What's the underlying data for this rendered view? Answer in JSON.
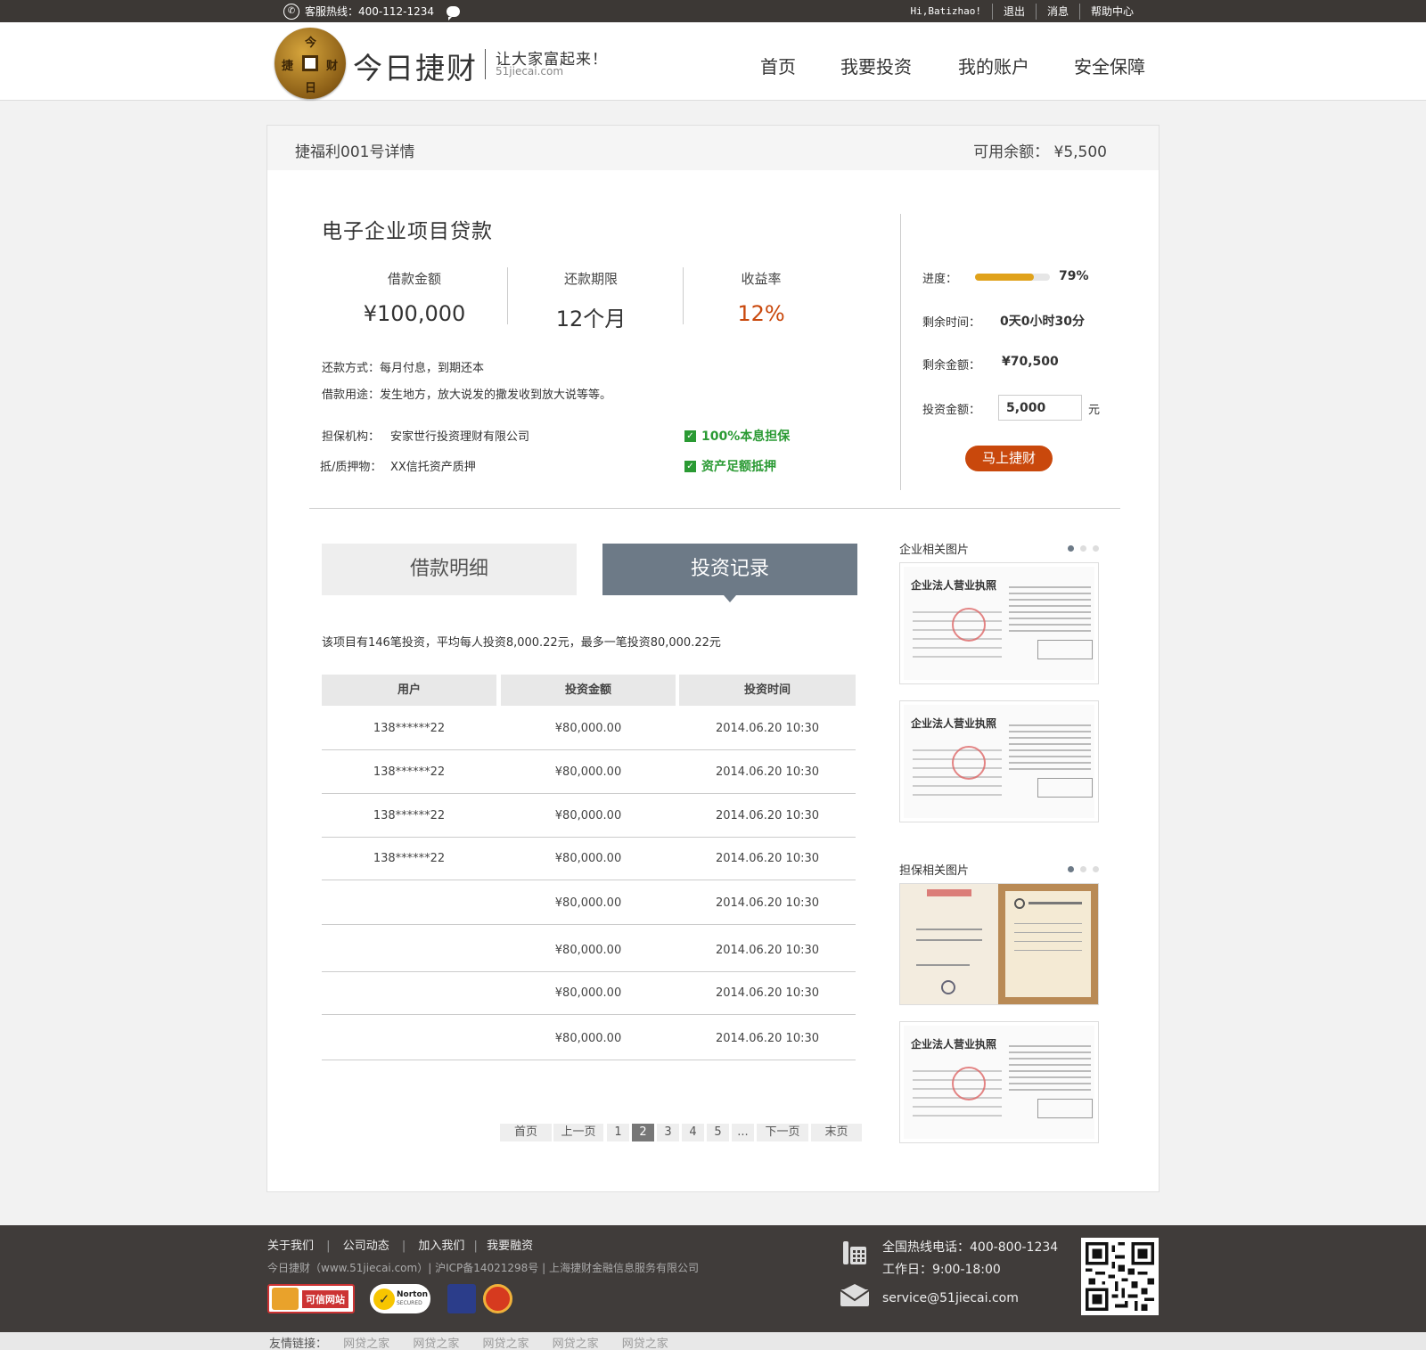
{
  "topbar": {
    "hotline": "客服热线：400-112-1234",
    "greeting": "Hi,Batizhao!",
    "logout": "退出",
    "messages": "消息",
    "help": "帮助中心"
  },
  "header": {
    "brand": "今日捷财",
    "coin_chars": [
      "今",
      "捷",
      "财",
      "日"
    ],
    "slogan": "让大家富起来！",
    "domain": "51jiecai.com",
    "nav": [
      "首页",
      "我要投资",
      "我的账户",
      "安全保障"
    ]
  },
  "card": {
    "title": "捷福利001号详情",
    "available_balance": "可用余额： ¥5,500"
  },
  "project": {
    "title": "电子企业项目贷款",
    "stats": [
      {
        "label": "借款金额",
        "value": "¥100,000"
      },
      {
        "label": "还款期限",
        "value": "12个月"
      },
      {
        "label": "收益率",
        "value": "12%"
      }
    ],
    "repay_method": "还款方式：每月付息，到期还本",
    "loan_purpose": "借款用途：发生地方，放大说发的撒发收到放大说等等。",
    "guarantor_label": "担保机构：",
    "guarantor": "安家世行投资理财有限公司",
    "collateral_label": "抵/质押物：",
    "collateral": "XX信托资产质押",
    "check1": "100%本息担保",
    "check2": "资产足额抵押"
  },
  "invest_panel": {
    "progress_label": "进度：",
    "progress_percent": 79,
    "progress_text": "79%",
    "remaining_time_label": "剩余时间：",
    "remaining_time": "0天0小时30分",
    "remaining_amount_label": "剩余金额：",
    "remaining_amount": "¥70,500",
    "invest_amount_label": "投资金额：",
    "invest_amount_value": "5,000",
    "unit": "元",
    "button": "马上捷财"
  },
  "tabs": {
    "tab1": "借款明细",
    "tab2": "投资记录"
  },
  "records": {
    "summary": "该项目有146笔投资，平均每人投资8,000.22元，最多一笔投资80,000.22元",
    "headers": [
      "用户",
      "投资金额",
      "投资时间"
    ],
    "rows": [
      {
        "user": "138******22",
        "amount": "¥80,000.00",
        "time": "2014.06.20  10:30"
      },
      {
        "user": "138******22",
        "amount": "¥80,000.00",
        "time": "2014.06.20  10:30"
      },
      {
        "user": "138******22",
        "amount": "¥80,000.00",
        "time": "2014.06.20  10:30"
      },
      {
        "user": "138******22",
        "amount": "¥80,000.00",
        "time": "2014.06.20  10:30"
      },
      {
        "user": "",
        "amount": "¥80,000.00",
        "time": "2014.06.20  10:30"
      },
      {
        "user": "",
        "amount": "¥80,000.00",
        "time": "2014.06.20  10:30"
      },
      {
        "user": "",
        "amount": "¥80,000.00",
        "time": "2014.06.20  10:30"
      },
      {
        "user": "",
        "amount": "¥80,000.00",
        "time": "2014.06.20  10:30"
      }
    ]
  },
  "pager": {
    "first": "首页",
    "prev": "上一页",
    "pages": [
      "1",
      "2",
      "3",
      "4",
      "5",
      "..."
    ],
    "active": "2",
    "next": "下一页",
    "last": "末页"
  },
  "side": {
    "company_images_title": "企业相关图片",
    "guarantee_images_title": "担保相关图片",
    "doc_title": "企业法人营业执照"
  },
  "footer": {
    "links": [
      "关于我们",
      "公司动态",
      "加入我们",
      "我要融资"
    ],
    "copyright": "今日捷财（www.51jiecai.com）| 沪ICP备14021298号 | 上海捷财金融信息服务有限公司",
    "badge1": "可信网站",
    "badge2": "Norton",
    "badge2_sub": "SECURED",
    "hotline": "全国热线电话：400-800-1234",
    "hours": "工作日：9:00-18:00",
    "email": "service@51jiecai.com",
    "friend_label": "友情链接：",
    "friend_links": [
      "网贷之家",
      "网贷之家",
      "网贷之家",
      "网贷之家",
      "网贷之家"
    ]
  }
}
